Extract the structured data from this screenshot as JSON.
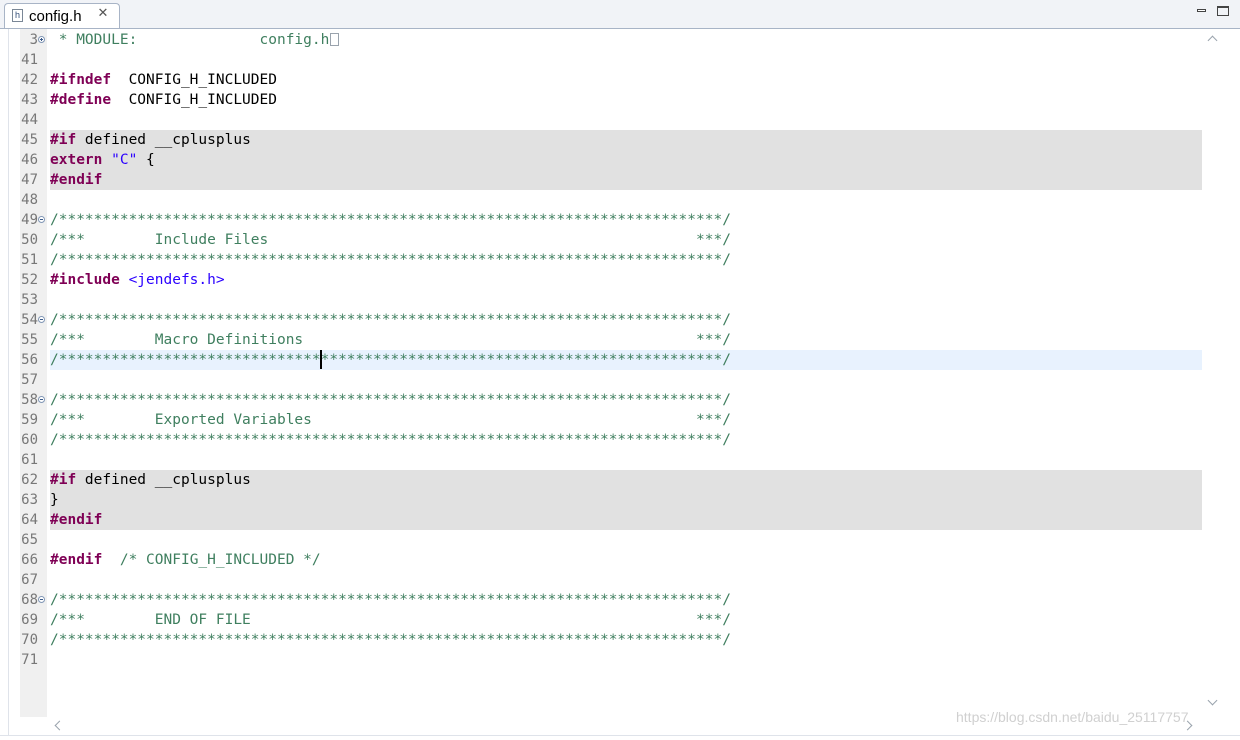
{
  "tab": {
    "title": "config.h",
    "icon": "h-file-icon"
  },
  "window_controls": {
    "minimize": "minimize-icon",
    "maximize": "maximize-icon"
  },
  "code_lines": [
    {
      "num": "3",
      "fold": "plus",
      "tokens": [
        {
          "t": " * MODULE:              config.h",
          "c": "cm"
        }
      ],
      "ellipsis": true
    },
    {
      "num": "41",
      "tokens": []
    },
    {
      "num": "42",
      "tokens": [
        {
          "t": "#ifndef",
          "c": "kw"
        },
        {
          "t": "  CONFIG_H_INCLUDED",
          "c": ""
        }
      ]
    },
    {
      "num": "43",
      "tokens": [
        {
          "t": "#define",
          "c": "kw"
        },
        {
          "t": "  CONFIG_H_INCLUDED",
          "c": ""
        }
      ]
    },
    {
      "num": "44",
      "tokens": []
    },
    {
      "num": "45",
      "hl": "gray",
      "tokens": [
        {
          "t": "#if",
          "c": "kw"
        },
        {
          "t": " defined __cplusplus",
          "c": ""
        }
      ]
    },
    {
      "num": "46",
      "hl": "gray",
      "tokens": [
        {
          "t": "extern",
          "c": "kw"
        },
        {
          "t": " ",
          "c": ""
        },
        {
          "t": "\"C\"",
          "c": "str"
        },
        {
          "t": " {",
          "c": ""
        }
      ]
    },
    {
      "num": "47",
      "hl": "gray",
      "tokens": [
        {
          "t": "#endif",
          "c": "kw"
        }
      ]
    },
    {
      "num": "48",
      "tokens": []
    },
    {
      "num": "49",
      "fold": "minus",
      "tokens": [
        {
          "t": "/****************************************************************************/",
          "c": "cm"
        }
      ]
    },
    {
      "num": "50",
      "tokens": [
        {
          "t": "/***        Include Files                                                 ***/",
          "c": "cm"
        }
      ]
    },
    {
      "num": "51",
      "tokens": [
        {
          "t": "/****************************************************************************/",
          "c": "cm"
        }
      ]
    },
    {
      "num": "52",
      "tokens": [
        {
          "t": "#include",
          "c": "kw"
        },
        {
          "t": " <jendefs.h>",
          "c": "inc"
        }
      ]
    },
    {
      "num": "53",
      "tokens": []
    },
    {
      "num": "54",
      "fold": "minus",
      "tokens": [
        {
          "t": "/****************************************************************************/",
          "c": "cm"
        }
      ]
    },
    {
      "num": "55",
      "tokens": [
        {
          "t": "/***        Macro Definitions                                             ***/",
          "c": "cm"
        }
      ]
    },
    {
      "num": "56",
      "hl": "blue",
      "caret": true,
      "tokens": [
        {
          "t": "/****************************************************************************/",
          "c": "cm"
        }
      ]
    },
    {
      "num": "57",
      "tokens": []
    },
    {
      "num": "58",
      "fold": "minus",
      "tokens": [
        {
          "t": "/****************************************************************************/",
          "c": "cm"
        }
      ]
    },
    {
      "num": "59",
      "tokens": [
        {
          "t": "/***        Exported Variables                                            ***/",
          "c": "cm"
        }
      ]
    },
    {
      "num": "60",
      "tokens": [
        {
          "t": "/****************************************************************************/",
          "c": "cm"
        }
      ]
    },
    {
      "num": "61",
      "tokens": []
    },
    {
      "num": "62",
      "hl": "gray",
      "tokens": [
        {
          "t": "#if",
          "c": "kw"
        },
        {
          "t": " defined __cplusplus",
          "c": ""
        }
      ]
    },
    {
      "num": "63",
      "hl": "gray",
      "tokens": [
        {
          "t": "}",
          "c": ""
        }
      ]
    },
    {
      "num": "64",
      "hl": "gray",
      "tokens": [
        {
          "t": "#endif",
          "c": "kw"
        }
      ]
    },
    {
      "num": "65",
      "tokens": []
    },
    {
      "num": "66",
      "tokens": [
        {
          "t": "#endif",
          "c": "kw"
        },
        {
          "t": "  /* CONFIG_H_INCLUDED */",
          "c": "cm"
        }
      ]
    },
    {
      "num": "67",
      "tokens": []
    },
    {
      "num": "68",
      "fold": "minus",
      "tokens": [
        {
          "t": "/****************************************************************************/",
          "c": "cm"
        }
      ]
    },
    {
      "num": "69",
      "tokens": [
        {
          "t": "/***        END OF FILE                                                   ***/",
          "c": "cm"
        }
      ]
    },
    {
      "num": "70",
      "tokens": [
        {
          "t": "/****************************************************************************/",
          "c": "cm"
        }
      ]
    },
    {
      "num": "71",
      "tokens": []
    }
  ],
  "watermark": "https://blog.csdn.net/baidu_25117757"
}
